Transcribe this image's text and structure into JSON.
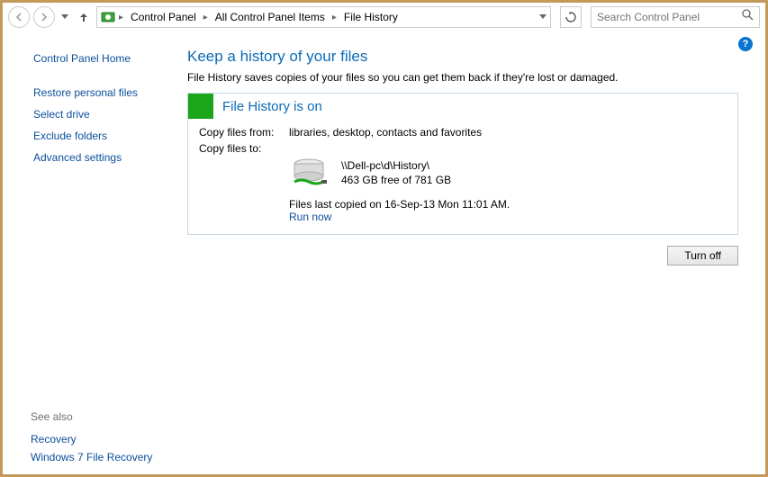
{
  "breadcrumb": {
    "items": [
      "Control Panel",
      "All Control Panel Items",
      "File History"
    ]
  },
  "search": {
    "placeholder": "Search Control Panel"
  },
  "sidebar": {
    "home": "Control Panel Home",
    "links": [
      "Restore personal files",
      "Select drive",
      "Exclude folders",
      "Advanced settings"
    ],
    "see_also_hdr": "See also",
    "see_also": [
      "Recovery",
      "Windows 7 File Recovery"
    ]
  },
  "main": {
    "title": "Keep a history of your files",
    "subtitle": "File History saves copies of your files so you can get them back if they're lost or damaged.",
    "status_title": "File History is on",
    "copy_from_label": "Copy files from:",
    "copy_from_value": "libraries, desktop, contacts and favorites",
    "copy_to_label": "Copy files to:",
    "drive_path": "\\\\Dell-pc\\d\\History\\",
    "drive_free": "463 GB free of 781 GB",
    "last_copied": "Files last copied on 16-Sep-13 Mon 11:01 AM.",
    "run_now": "Run now",
    "turn_off": "Turn off"
  }
}
